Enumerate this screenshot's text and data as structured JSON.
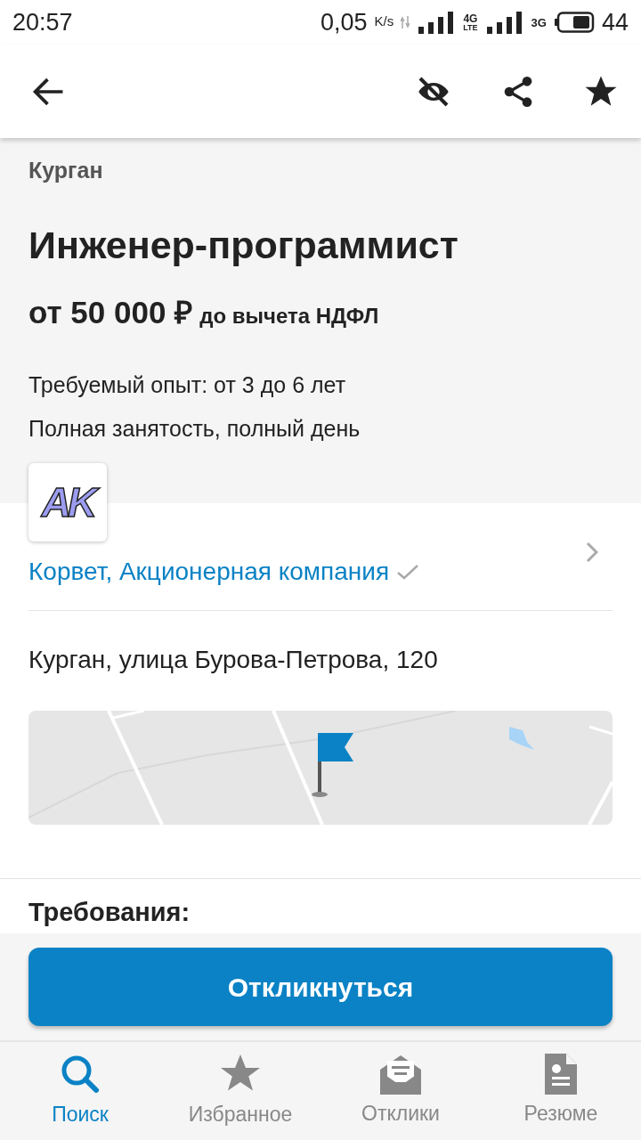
{
  "status_bar": {
    "time": "20:57",
    "speed": "0,05",
    "speed_unit": "K/s",
    "net1": "4G",
    "net1_sub": "LTE",
    "net2": "3G",
    "battery": "44"
  },
  "vacancy": {
    "city": "Курган",
    "title": "Инженер-программист",
    "salary": "от 50 000 ₽",
    "salary_note": "до вычета НДФЛ",
    "experience": "Требуемый опыт: от 3 до 6 лет",
    "employment": "Полная занятость, полный день"
  },
  "company": {
    "logo_text": "AK",
    "name": "Корвет, Акционерная компания",
    "verified": true
  },
  "address": "Курган, улица Бурова-Петрова, 120",
  "section_heading": "Требования:",
  "apply_button": "Откликнуться",
  "bottom_nav": [
    {
      "label": "Поиск",
      "selected": true
    },
    {
      "label": "Избранное",
      "selected": false
    },
    {
      "label": "Отклики",
      "selected": false
    },
    {
      "label": "Резюме",
      "selected": false
    }
  ]
}
